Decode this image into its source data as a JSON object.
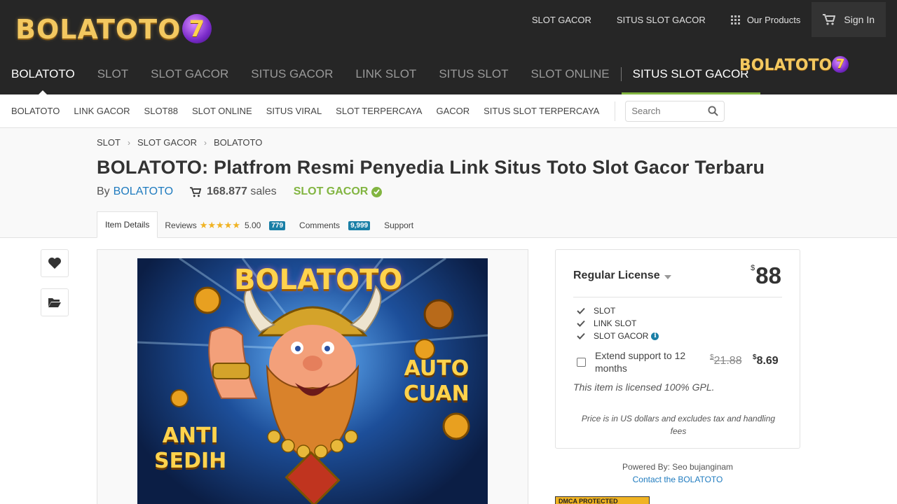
{
  "logo": {
    "text": "BOLATOTO",
    "digit": "7"
  },
  "topnav": {
    "items": [
      "SLOT GACOR",
      "SITUS SLOT GACOR"
    ],
    "products": "Our Products",
    "signin": "Sign In"
  },
  "mainnav": {
    "items": [
      "BOLATOTO",
      "SLOT",
      "SLOT GACOR",
      "SITUS GACOR",
      "LINK SLOT",
      "SITUS SLOT",
      "SLOT ONLINE"
    ],
    "active": "SITUS SLOT GACOR"
  },
  "subnav": {
    "items": [
      "BOLATOTO",
      "LINK GACOR",
      "SLOT88",
      "SLOT ONLINE",
      "SITUS VIRAL",
      "SLOT TERPERCAYA",
      "GACOR",
      "SITUS SLOT TERPERCAYA"
    ],
    "search_placeholder": "Search"
  },
  "breadcrumb": [
    "SLOT",
    "SLOT GACOR",
    "BOLATOTO"
  ],
  "item": {
    "title": "BOLATOTO: Platfrom Resmi Penyedia Link Situs Toto Slot Gacor Terbaru",
    "by": "By",
    "author": "BOLATOTO",
    "sales_count": "168.877",
    "sales_label": "sales",
    "badge": "SLOT GACOR"
  },
  "tabs": {
    "details": "Item Details",
    "reviews": "Reviews",
    "stars": "★★★★★",
    "rating": "5.00",
    "reviews_count": "779",
    "comments": "Comments",
    "comments_count": "9,999",
    "support": "Support"
  },
  "hero": {
    "title": "BOLATOTO",
    "right_text_1": "AUTO",
    "right_text_2": "CUAN",
    "left_text_1": "ANTI",
    "left_text_2": "SEDIH"
  },
  "license": {
    "name": "Regular License",
    "currency": "$",
    "price": "88",
    "features": [
      "SLOT",
      "LINK SLOT",
      "SLOT GACOR"
    ],
    "extend_text": "Extend support to 12 months",
    "old_price": "21.88",
    "new_price": "8.69",
    "gpl": "This item is licensed 100% GPL.",
    "note": "Price is in US dollars and excludes tax and handling fees"
  },
  "footer": {
    "powered": "Powered By: Seo bujanginam",
    "contact": "Contact the BOLATOTO",
    "dmca": "DMCA PROTECTED"
  },
  "colors": {
    "accent_green": "#82b541",
    "link_blue": "#1f7bbf",
    "header_bg": "#262626",
    "badge_blue": "#1a7fa6"
  }
}
